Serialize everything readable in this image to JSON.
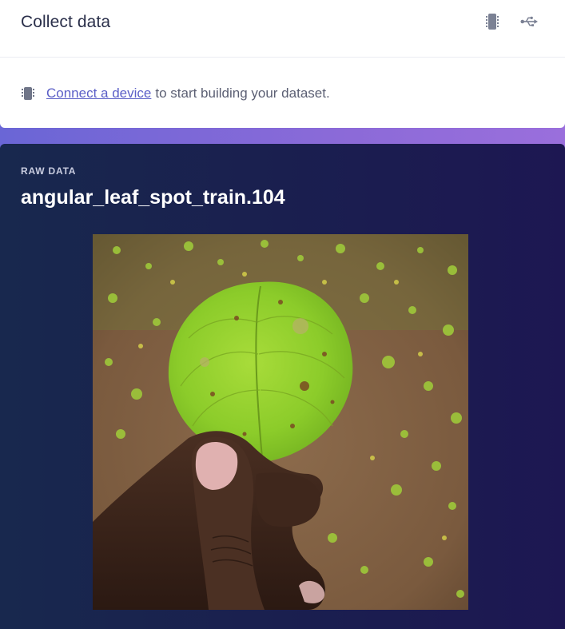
{
  "header": {
    "title": "Collect data",
    "device_icon": "device-chip-icon",
    "usb_icon": "usb-icon"
  },
  "connect": {
    "icon": "device-chip-icon",
    "link_text": "Connect a device",
    "rest_text": "to start building your dataset."
  },
  "raw_data": {
    "label": "RAW DATA",
    "sample_name": "angular_leaf_spot_train.104"
  },
  "image": {
    "subject": "leaf-photo"
  },
  "colors": {
    "accent": "#6a66d6",
    "link": "#5b5fc7",
    "panel_bg": "#1a1f4f"
  }
}
